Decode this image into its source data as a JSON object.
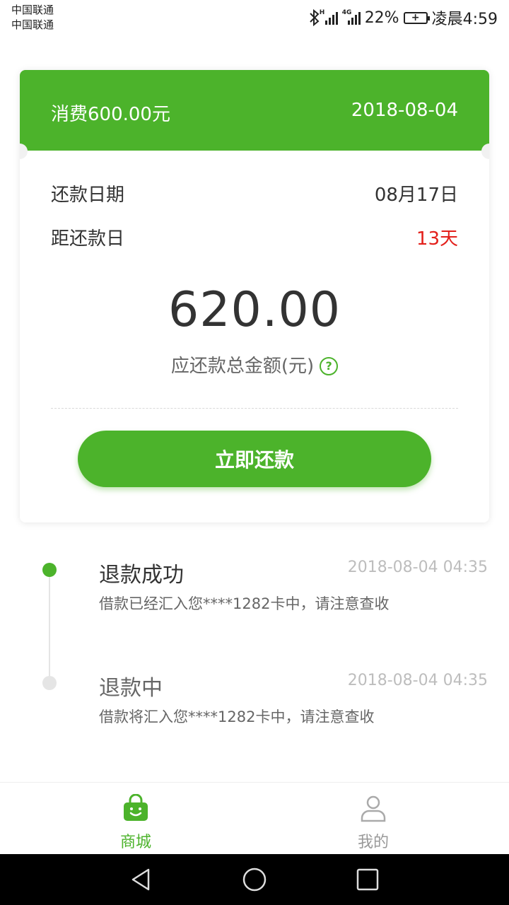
{
  "status_bar": {
    "carrier_1": "中国联通",
    "carrier_2": "中国联通",
    "signal_tag_1": "H",
    "signal_tag_2": "4G",
    "battery_percent": "22%",
    "time": "凌晨4:59"
  },
  "card": {
    "header_left": "消费600.00元",
    "header_right": "2018-08-04",
    "repay_date_label": "还款日期",
    "repay_date_value": "08月17日",
    "days_left_label": "距还款日",
    "days_left_value": "13天",
    "amount": "620.00",
    "amount_label": "应还款总金额(元)",
    "help_icon_text": "?",
    "pay_button": "立即还款"
  },
  "timeline": [
    {
      "title": "退款成功",
      "time": "2018-08-04 04:35",
      "desc": "借款已经汇入您****1282卡中，请注意查收"
    },
    {
      "title": "退款中",
      "time": "2018-08-04 04:35",
      "desc": "借款将汇入您****1282卡中，请注意查收"
    }
  ],
  "tabbar": {
    "tabs": [
      {
        "label": "商城",
        "icon": "shopping-bag-icon",
        "active": true
      },
      {
        "label": "我的",
        "icon": "user-icon",
        "active": false
      }
    ]
  },
  "colors": {
    "accent": "#4cb32b",
    "danger": "#e3201b"
  }
}
